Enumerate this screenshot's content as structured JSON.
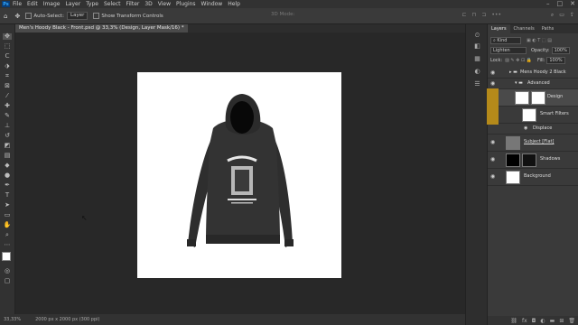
{
  "menubar": {
    "logo": "Ps",
    "items": [
      "File",
      "Edit",
      "Image",
      "Layer",
      "Type",
      "Select",
      "Filter",
      "3D",
      "View",
      "Plugins",
      "Window",
      "Help"
    ],
    "controls": [
      "–",
      "□",
      "✕"
    ]
  },
  "options": {
    "auto_select_label": "Auto-Select:",
    "target_value": "Layer",
    "transform_label": "Show Transform Controls",
    "mode_label": "3D Mode:"
  },
  "document": {
    "tab_title": "Men's Hoody Black - Front.psd @ 33,3% (Design, Layer Mask/16) *"
  },
  "status": {
    "zoom": "33,33%",
    "info": "2000 px x 2000 px (300 ppi)"
  },
  "layers_panel": {
    "tabs": [
      "Layers",
      "Channels",
      "Paths"
    ],
    "filter_label": "Kind",
    "blend_mode": "Lighten",
    "opacity_label": "Opacity:",
    "opacity_value": "100%",
    "lock_label": "Lock:",
    "fill_label": "Fill:",
    "fill_value": "100%",
    "layers": [
      {
        "name": "Mens Hoody 2 Black"
      },
      {
        "name": "Advanced"
      },
      {
        "name": "Design"
      },
      {
        "name": "Smart Filters"
      },
      {
        "name": "Displace"
      },
      {
        "name": "Subject [Flat]"
      },
      {
        "name": "Shadows"
      },
      {
        "name": "Background"
      }
    ]
  },
  "colors": {
    "accent": "#b58a1a",
    "ps_logo_bg": "#0a3d77"
  }
}
